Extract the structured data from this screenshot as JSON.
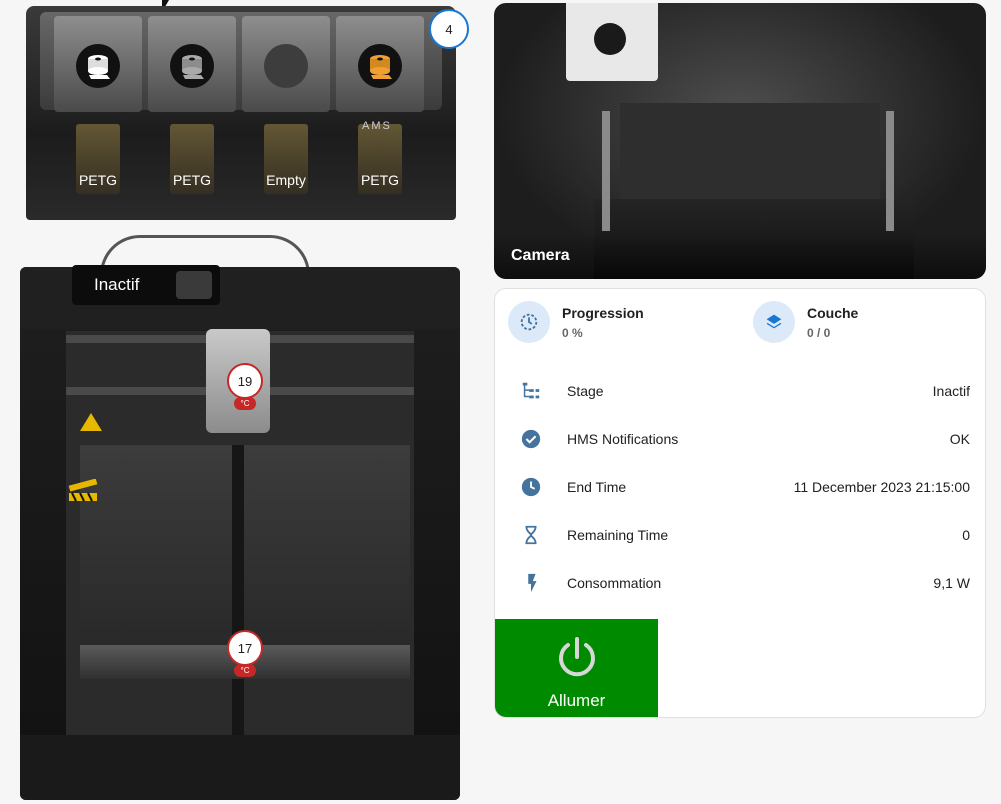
{
  "ams": {
    "count_badge": "4",
    "brand": "AMS",
    "slots": [
      {
        "label": "PETG",
        "icon": "spool-icon",
        "color": "#ffffff"
      },
      {
        "label": "PETG",
        "icon": "spool-icon",
        "color": "#9e9e9e"
      },
      {
        "label": "Empty",
        "icon": "empty-slot-icon",
        "color": "#3d3d3d"
      },
      {
        "label": "PETG",
        "icon": "spool-icon",
        "color": "#f0a030"
      }
    ]
  },
  "printer": {
    "status": "Inactif",
    "nozzle_temp": "19",
    "bed_temp": "17",
    "temp_unit": "°C",
    "timelapse_icon": "timelapse-icon"
  },
  "camera": {
    "caption": "Camera"
  },
  "info": {
    "progress": {
      "label": "Progression",
      "value": "0 %",
      "icon": "progress-clock-icon"
    },
    "layer": {
      "label": "Couche",
      "value": "0 / 0",
      "icon": "layers-icon"
    },
    "rows": [
      {
        "label": "Stage",
        "value": "Inactif",
        "icon": "stage-tree-icon"
      },
      {
        "label": "HMS Notifications",
        "value": "OK",
        "icon": "check-circle-icon"
      },
      {
        "label": "End Time",
        "value": "11 December 2023 21:15:00",
        "icon": "clock-icon"
      },
      {
        "label": "Remaining Time",
        "value": "0",
        "icon": "hourglass-icon"
      },
      {
        "label": "Consommation",
        "value": "9,1 W",
        "icon": "flash-icon"
      }
    ],
    "power_button": {
      "label": "Allumer",
      "icon": "power-icon",
      "color": "#008a00"
    }
  },
  "colors": {
    "icon_blue": "#44739e",
    "badge_red": "#c62828",
    "accent_blue": "#1976d2"
  }
}
